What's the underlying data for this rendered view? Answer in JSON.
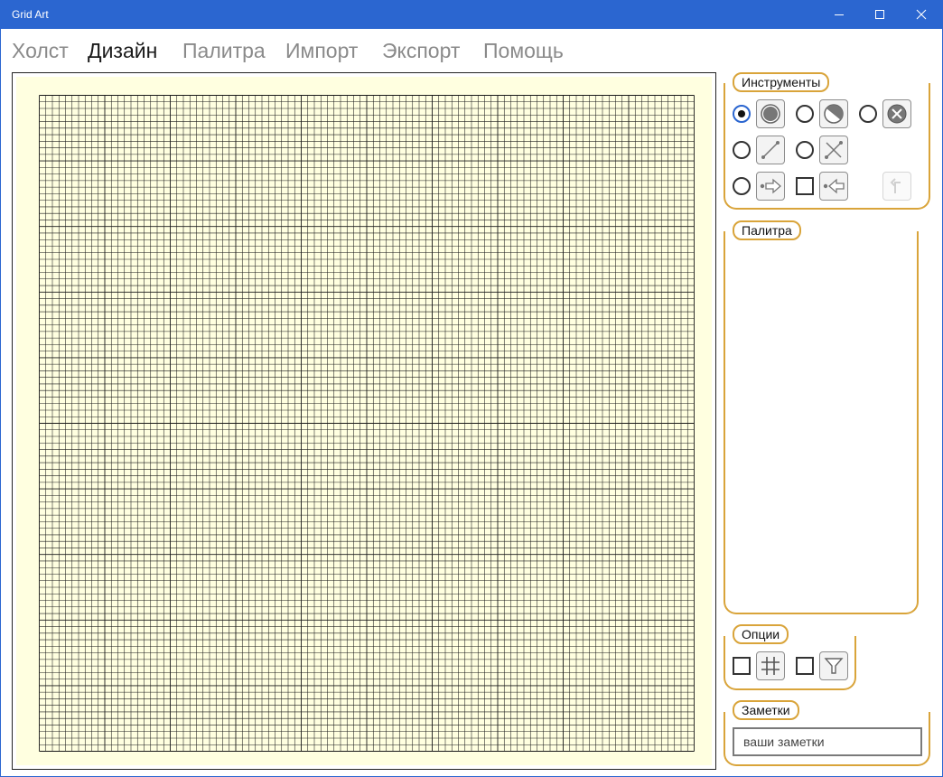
{
  "window": {
    "title": "Grid Art"
  },
  "menu": [
    {
      "label": "Холст",
      "active": false
    },
    {
      "label": "Дизайн",
      "active": true
    },
    {
      "label": "Палитра",
      "active": false
    },
    {
      "label": "Импорт",
      "active": false
    },
    {
      "label": "Экспорт",
      "active": false
    },
    {
      "label": "Помощь",
      "active": false
    }
  ],
  "tools_group": {
    "header": "Инструменты",
    "tools": [
      {
        "icon": "filled-circle-icon",
        "selected": true
      },
      {
        "icon": "half-circle-icon",
        "selected": false
      },
      {
        "icon": "circle-x-icon",
        "selected": false
      },
      {
        "icon": "diagonal-line-icon",
        "selected": false
      },
      {
        "icon": "cross-lines-icon",
        "selected": false
      },
      {
        "icon": "arrow-right-icon",
        "selected": false
      },
      {
        "icon": "arrow-left-icon",
        "checked": false
      },
      {
        "icon": "undo-arrow-icon",
        "enabled": false
      }
    ]
  },
  "palette_group": {
    "header": "Палитра"
  },
  "options_group": {
    "header": "Опции",
    "options": [
      {
        "icon": "grid-icon",
        "checked": false
      },
      {
        "icon": "filter-icon",
        "checked": false
      }
    ]
  },
  "notes_group": {
    "header": "Заметки",
    "placeholder": "ваши заметки",
    "value": ""
  },
  "colors": {
    "titlebar": "#2b66d0",
    "accent": "#d9a43a",
    "canvas_paper": "#ffffe0",
    "grid_line": "#1a1a1a"
  }
}
